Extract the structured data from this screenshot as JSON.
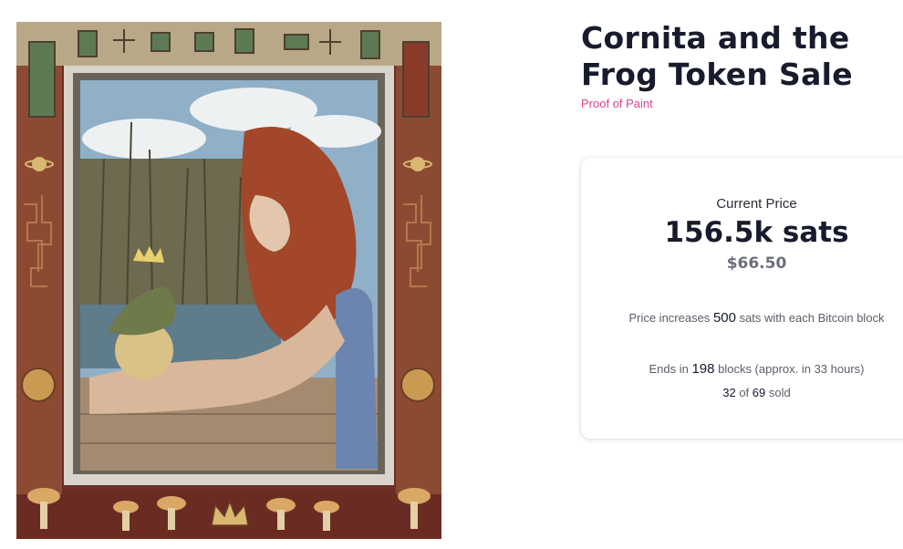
{
  "artwork": {
    "icon": "artwork-image"
  },
  "header": {
    "title": "Cornita and the Frog Token Sale",
    "subtitle": "Proof of Paint"
  },
  "price_card": {
    "label": "Current Price",
    "price_sats": "156.5k sats",
    "price_usd": "$66.50",
    "increase_prefix": "Price increases ",
    "increase_amount": "500",
    "increase_suffix": " sats with each Bitcoin block",
    "ends_prefix": "Ends in ",
    "ends_blocks": "198",
    "ends_suffix": " blocks (approx. in 33 hours)",
    "sold_count": "32",
    "sold_of": " of ",
    "sold_total": "69",
    "sold_suffix": " sold"
  },
  "colors": {
    "title": "#171b2c",
    "accent": "#d9458c",
    "muted": "#6b6f7a"
  }
}
